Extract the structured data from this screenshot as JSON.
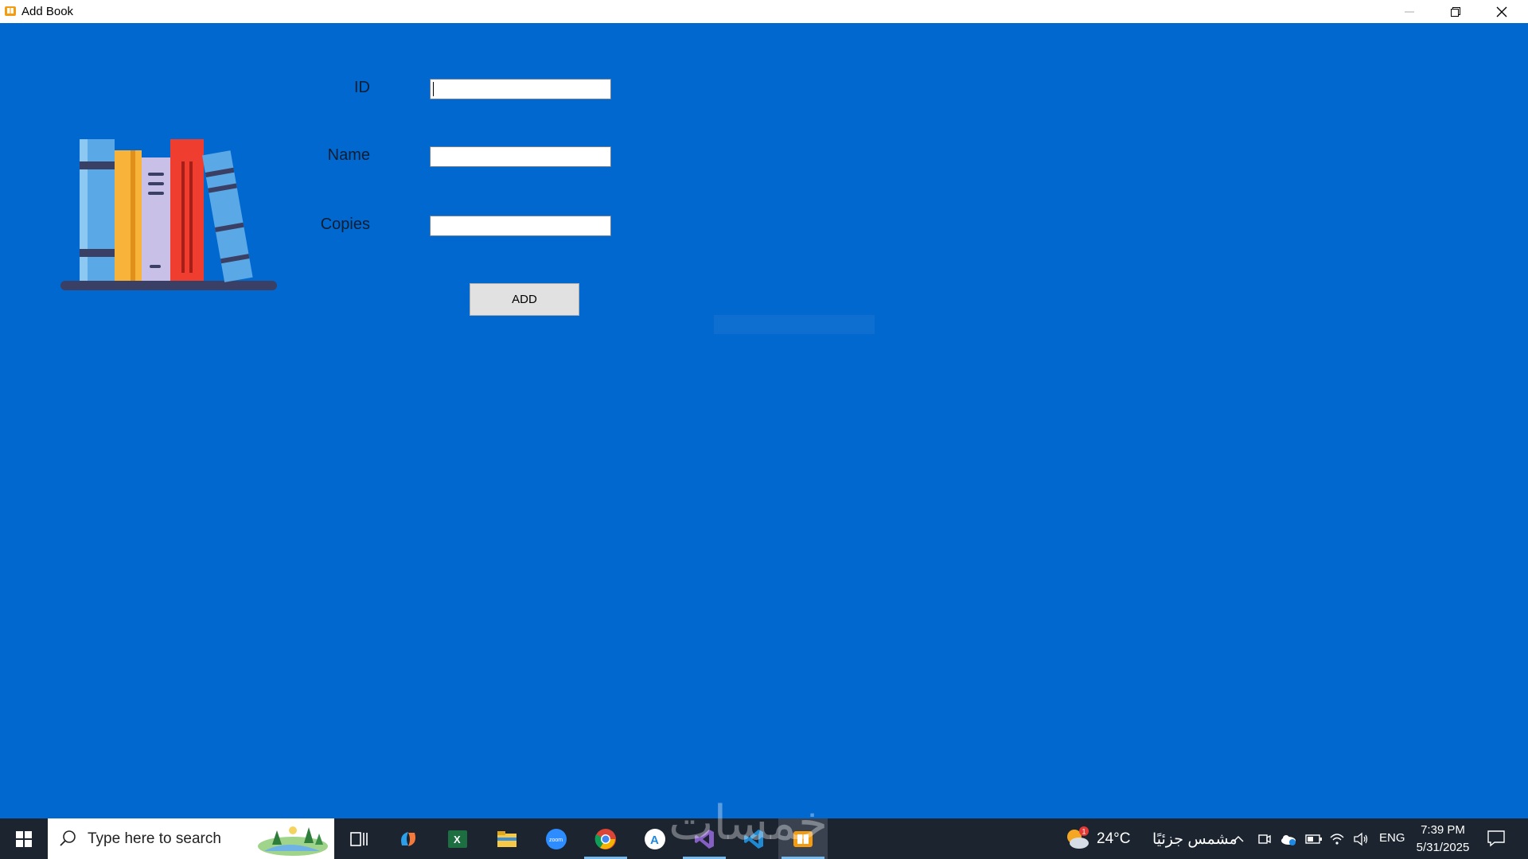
{
  "window": {
    "title": "Add Book"
  },
  "form": {
    "id_label": "ID",
    "name_label": "Name",
    "copies_label": "Copies",
    "id_value": "",
    "name_value": "",
    "copies_value": "",
    "add_button": "ADD"
  },
  "taskbar": {
    "search_placeholder": "Type here to search",
    "apps": [
      "copilot-icon",
      "excel-icon",
      "file-explorer-icon",
      "zoom-icon",
      "chrome-icon",
      "app-store-icon",
      "visual-studio-icon",
      "vscode-icon",
      "library-app-icon"
    ],
    "weather_temp": "24°C",
    "weather_desc": "مشمس جزئيًا",
    "weather_badge": "1",
    "language": "ENG",
    "time": "7:39 PM",
    "date": "5/31/2025"
  },
  "watermark": "خمسات",
  "colors": {
    "client_background": "#0068ce",
    "taskbar": "#1c2430",
    "button": "#e1e1e1"
  }
}
